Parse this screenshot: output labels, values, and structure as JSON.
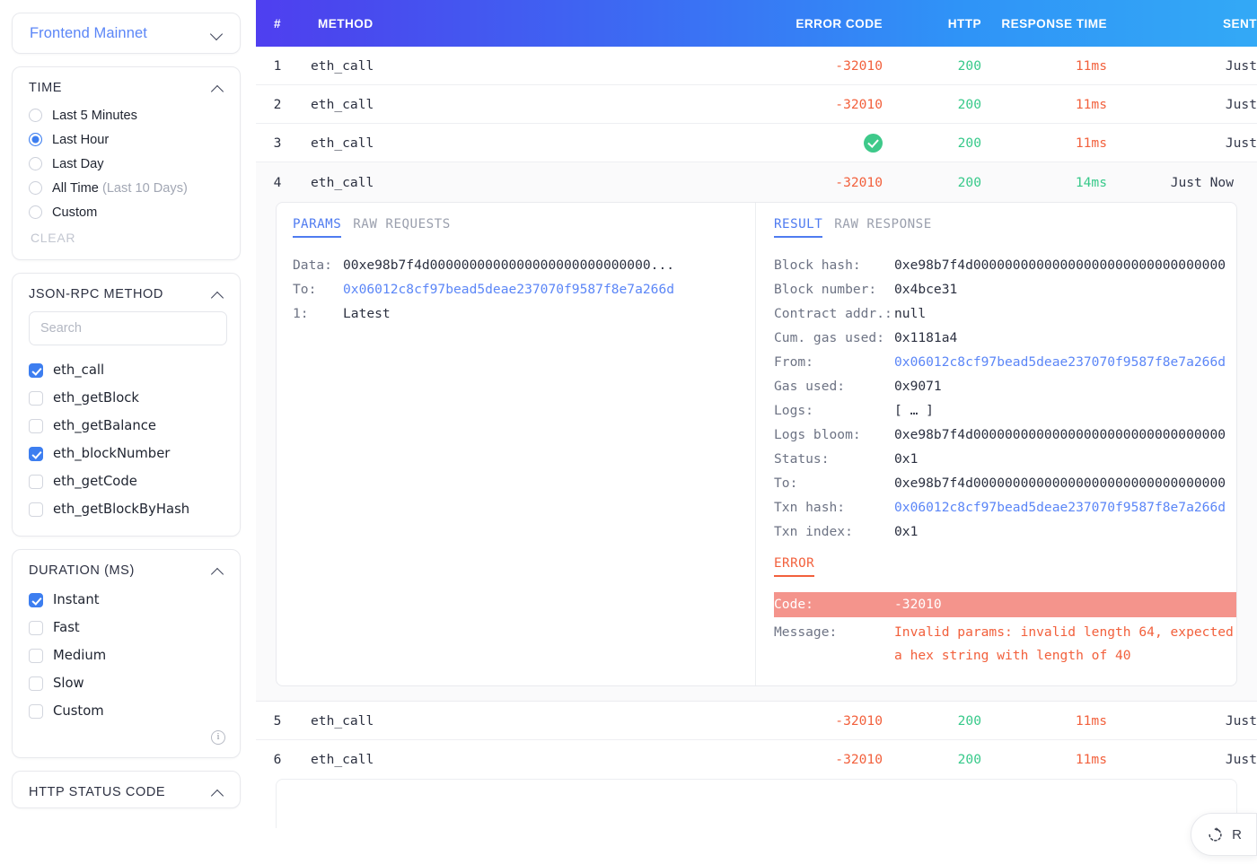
{
  "sidebar": {
    "network_select": {
      "value": "Frontend Mainnet",
      "chevron": "chevron-down-icon"
    },
    "time": {
      "title": "TIME",
      "options": [
        {
          "label": "Last 5 Minutes",
          "selected": false
        },
        {
          "label": "Last Hour",
          "selected": true
        },
        {
          "label": "Last Day",
          "selected": false
        },
        {
          "label": "All Time",
          "suffix": " (Last 10 Days)",
          "selected": false
        },
        {
          "label": "Custom",
          "selected": false
        }
      ],
      "clear_label": "CLEAR"
    },
    "method": {
      "title": "JSON-RPC METHOD",
      "search_placeholder": "Search",
      "search_value": "",
      "options": [
        {
          "label": "eth_call",
          "checked": true
        },
        {
          "label": "eth_getBlock",
          "checked": false
        },
        {
          "label": "eth_getBalance",
          "checked": false
        },
        {
          "label": "eth_blockNumber",
          "checked": true
        },
        {
          "label": "eth_getCode",
          "checked": false
        },
        {
          "label": "eth_getBlockByHash",
          "checked": false
        }
      ]
    },
    "duration": {
      "title": "DURATION (MS)",
      "options": [
        {
          "label": "Instant",
          "checked": true
        },
        {
          "label": "Fast",
          "checked": false
        },
        {
          "label": "Medium",
          "checked": false
        },
        {
          "label": "Slow",
          "checked": false
        },
        {
          "label": "Custom",
          "checked": false
        }
      ],
      "info_icon": "info-icon"
    },
    "http_status": {
      "title": "HTTP STATUS CODE"
    }
  },
  "table": {
    "columns": [
      "#",
      "METHOD",
      "ERROR CODE",
      "HTTP",
      "RESPONSE TIME",
      "SENT"
    ],
    "rows": [
      {
        "num": "1",
        "method": "eth_call",
        "error_code": "-32010",
        "http": "200",
        "response_time": "11ms",
        "sent": "Just"
      },
      {
        "num": "2",
        "method": "eth_call",
        "error_code": "-32010",
        "http": "200",
        "response_time": "11ms",
        "sent": "Just"
      },
      {
        "num": "3",
        "method": "eth_call",
        "error_code": "",
        "status_icon": "success-check-icon",
        "http": "200",
        "response_time": "11ms",
        "sent": "Just"
      },
      {
        "num": "5",
        "method": "eth_call",
        "error_code": "-32010",
        "http": "200",
        "response_time": "11ms",
        "sent": "Just"
      },
      {
        "num": "6",
        "method": "eth_call",
        "error_code": "-32010",
        "http": "200",
        "response_time": "11ms",
        "sent": "Just"
      }
    ],
    "expanded_row": {
      "num": "4",
      "method": "eth_call",
      "error_code": "-32010",
      "http": "200",
      "response_time": "14ms",
      "sent": "Just Now"
    }
  },
  "detail": {
    "request": {
      "tabs": [
        {
          "label": "PARAMS",
          "active": true
        },
        {
          "label": "RAW REQUESTS",
          "active": false
        }
      ],
      "fields": [
        {
          "key": "Data:",
          "value": "00xe98b7f4d0000000000000000000000000000...",
          "link": false
        },
        {
          "key": "To:",
          "value": "0x06012c8cf97bead5deae237070f9587f8e7a266d",
          "link": true
        },
        {
          "key": "1:",
          "value": "Latest",
          "link": false
        }
      ]
    },
    "response": {
      "tabs": [
        {
          "label": "RESULT",
          "active": true
        },
        {
          "label": "RAW RESPONSE",
          "active": false
        }
      ],
      "fields": [
        {
          "key": "Block hash:",
          "value": "0xe98b7f4d00000000000000000000000000000000",
          "link": false
        },
        {
          "key": "Block number:",
          "value": "0x4bce31",
          "link": false
        },
        {
          "key": "Contract addr.:",
          "value": "null",
          "link": false
        },
        {
          "key": "Cum. gas used:",
          "value": "0x1181a4",
          "link": false
        },
        {
          "key": "From:",
          "value": "0x06012c8cf97bead5deae237070f9587f8e7a266d",
          "link": true
        },
        {
          "key": "Gas used:",
          "value": "0x9071",
          "link": false
        },
        {
          "key": "Logs:",
          "value": "[ … ]",
          "link": false
        },
        {
          "key": "Logs bloom:",
          "value": "0xe98b7f4d00000000000000000000000000000000",
          "link": false
        },
        {
          "key": "Status:",
          "value": "0x1",
          "link": false
        },
        {
          "key": "To:",
          "value": "0xe98b7f4d00000000000000000000000000000000",
          "link": false
        },
        {
          "key": "Txn hash:",
          "value": "0x06012c8cf97bead5deae237070f9587f8e7a266d",
          "link": true
        },
        {
          "key": "Txn index:",
          "value": "0x1",
          "link": false
        }
      ],
      "error": {
        "tab_label": "ERROR",
        "code_key": "Code:",
        "code_value": "-32010",
        "message_key": "Message:",
        "message_value": "Invalid params: invalid length 64, expected a hex string with length of 40"
      }
    }
  },
  "refresh_button": {
    "label": "R",
    "icon": "refresh-icon"
  },
  "colors": {
    "accent_blue": "#3d7ef0",
    "link_blue": "#5b86f7",
    "error_red": "#f2603c",
    "success_green": "#37c98a",
    "error_bg": "#f4948c",
    "header_gradient_start": "#4f3ff0",
    "header_gradient_end": "#33a9f6"
  }
}
